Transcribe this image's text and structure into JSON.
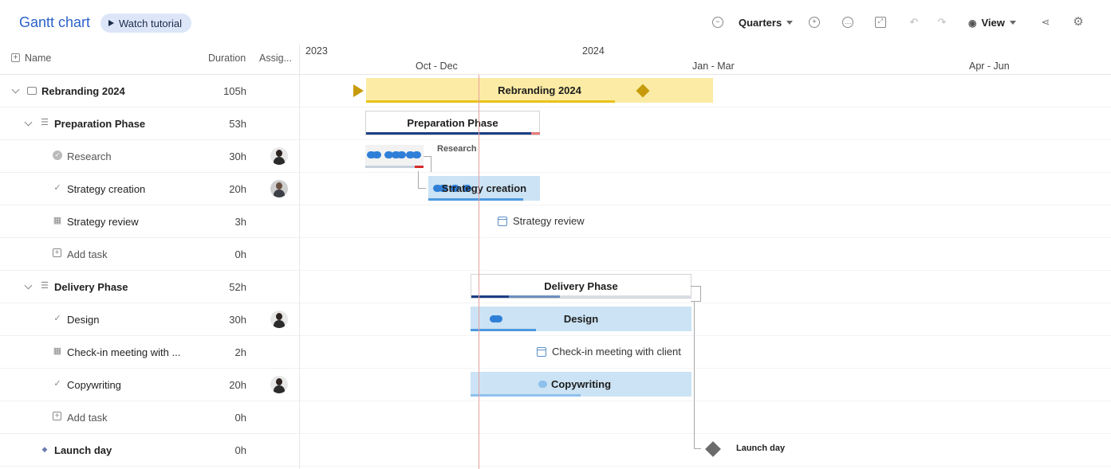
{
  "toolbar": {
    "title": "Gantt chart",
    "tutorial_label": "Watch tutorial",
    "zoom_level": "Quarters",
    "view_label": "View",
    "icons": [
      "zoom-out-icon",
      "zoom-in-icon",
      "comment-icon",
      "expand-icon",
      "undo-icon",
      "redo-icon",
      "eye-icon",
      "share-icon",
      "gear-icon"
    ]
  },
  "grid": {
    "columns": {
      "name": "Name",
      "duration": "Duration",
      "assignee": "Assig..."
    },
    "rows": [
      {
        "name": "Rebranding 2024",
        "duration": "105h",
        "type": "project"
      },
      {
        "name": "Preparation Phase",
        "duration": "53h",
        "type": "phase"
      },
      {
        "name": "Research",
        "duration": "30h",
        "type": "task-done",
        "assignee": "avatar-woman"
      },
      {
        "name": "Strategy creation",
        "duration": "20h",
        "type": "task",
        "assignee": "avatar-man"
      },
      {
        "name": "Strategy review",
        "duration": "3h",
        "type": "event"
      },
      {
        "name": "Add task",
        "duration": "0h",
        "type": "add"
      },
      {
        "name": "Delivery Phase",
        "duration": "52h",
        "type": "phase"
      },
      {
        "name": "Design",
        "duration": "30h",
        "type": "task",
        "assignee": "avatar-woman"
      },
      {
        "name": "Check-in meeting with ...",
        "duration": "2h",
        "type": "event"
      },
      {
        "name": "Copywriting",
        "duration": "20h",
        "type": "task",
        "assignee": "avatar-woman"
      },
      {
        "name": "Add task",
        "duration": "0h",
        "type": "add"
      },
      {
        "name": "Launch day",
        "duration": "0h",
        "type": "milestone"
      }
    ]
  },
  "timeline": {
    "years": [
      "2023",
      "2024"
    ],
    "quarters": [
      "Oct - Dec",
      "Jan - Mar",
      "Apr - Jun"
    ],
    "bars": {
      "project": "Rebranding 2024",
      "prep_phase": "Preparation Phase",
      "research": "Research",
      "strategy": "Strategy creation",
      "review": "Strategy review",
      "delivery_phase": "Delivery Phase",
      "design": "Design",
      "checkin": "Check-in meeting with client",
      "copy": "Copywriting",
      "launch": "Launch day"
    }
  },
  "colors": {
    "accent": "#2b63c9",
    "project_bar": "#fbeba4",
    "project_progress": "#e8c21a",
    "task_bar": "#cbe3f4",
    "task_progress": "#4d98df",
    "phase_progress": "#1b3f86",
    "milestone_gold": "#c79a0a",
    "milestone_gray": "#6b6b6b",
    "today_line": "#e7a0a0"
  }
}
